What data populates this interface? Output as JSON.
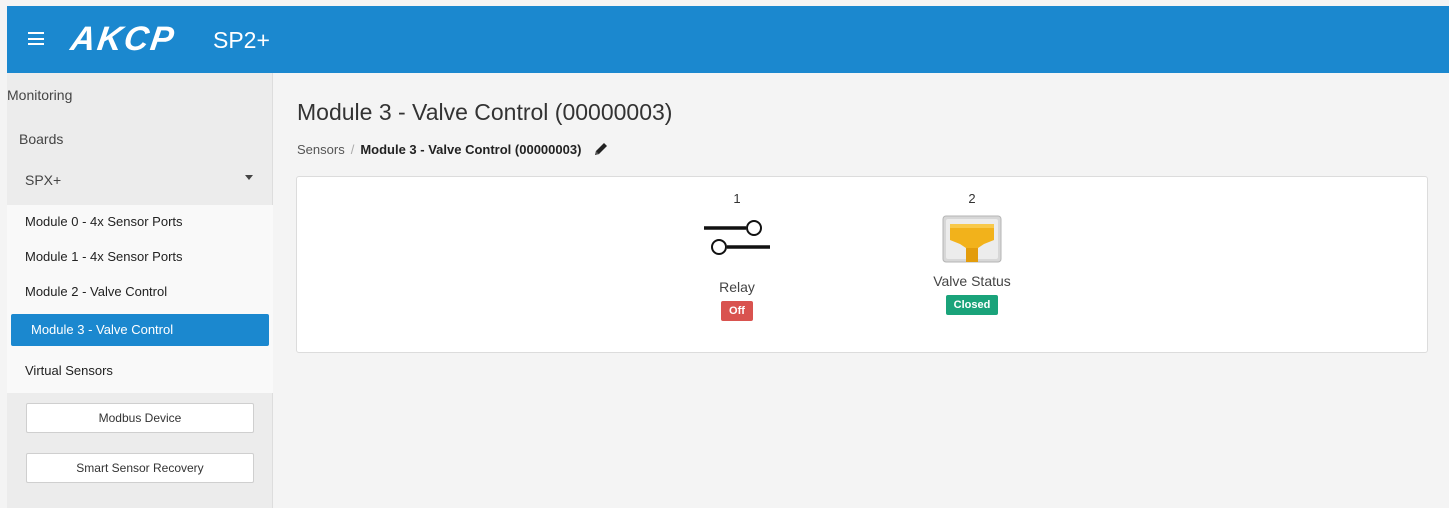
{
  "header": {
    "logo": "AKCP",
    "product": "SP2+"
  },
  "sidebar": {
    "monitoring": "Monitoring",
    "boards": "Boards",
    "board_select": "SPX+",
    "modules": [
      "Module 0 - 4x Sensor Ports",
      "Module 1 - 4x Sensor Ports",
      "Module 2 - Valve Control",
      "Module 3 - Valve Control"
    ],
    "virtual_sensors": "Virtual Sensors",
    "modbus_button": "Modbus Device",
    "recovery_button": "Smart Sensor Recovery"
  },
  "page": {
    "title": "Module 3 - Valve Control (00000003)",
    "breadcrumb": {
      "root": "Sensors",
      "separator": "/",
      "current": "Module 3 - Valve Control (00000003)"
    }
  },
  "sensors": [
    {
      "number": "1",
      "name": "Relay",
      "status": "Off",
      "status_color": "#d9534f",
      "icon": "relay-switch-icon"
    },
    {
      "number": "2",
      "name": "Valve Status",
      "status": "Closed",
      "status_color": "#1aa37a",
      "icon": "valve-icon"
    }
  ],
  "colors": {
    "accent": "#1b88cf"
  }
}
